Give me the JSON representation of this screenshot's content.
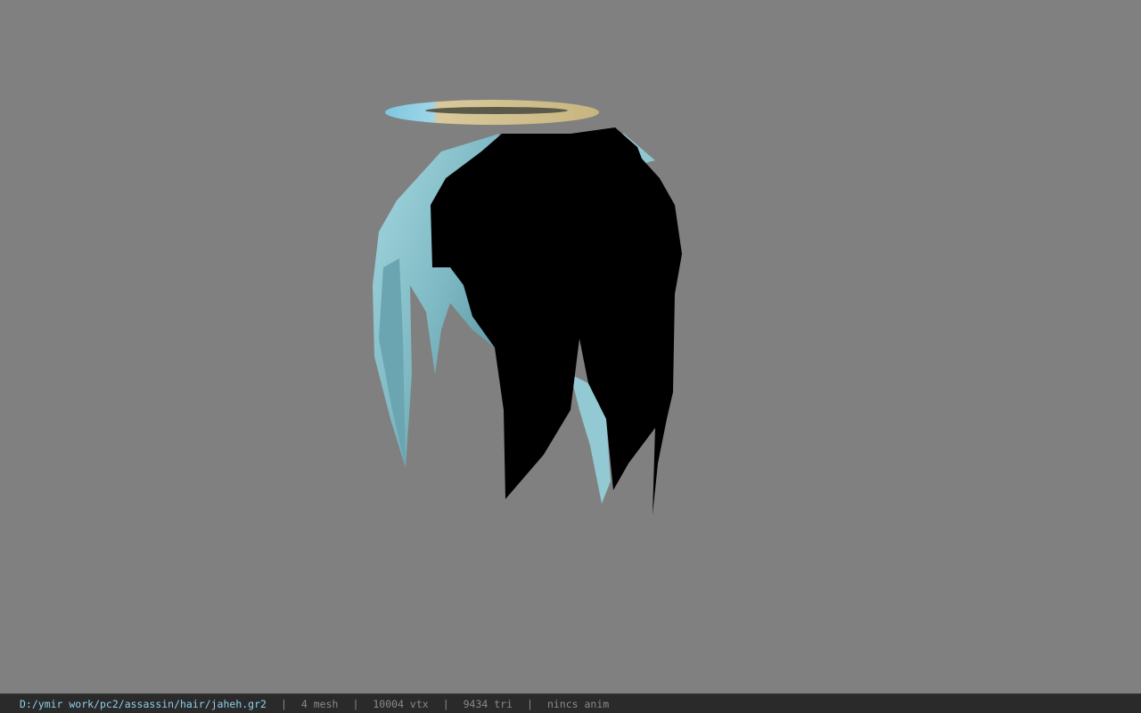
{
  "viewer": {
    "background_color": "#808080",
    "model_colors": {
      "hair_shadow": "#000000",
      "hair_light": "#8fc6cf",
      "halo_blue": "#86c9dd",
      "halo_gold": "#d7c89a"
    }
  },
  "statusbar": {
    "file_path": "D:/ymir work/pc2/assassin/hair/jaheh.gr2",
    "separator": "|",
    "mesh_count": "4 mesh",
    "vertex_count": "10004 vtx",
    "triangle_count": "9434 tri",
    "anim_status": "nincs anim"
  }
}
